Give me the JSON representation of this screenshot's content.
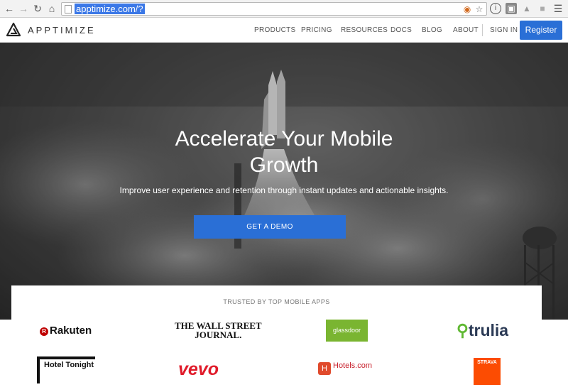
{
  "browser": {
    "url": "apptimize.com/?",
    "icons": [
      "back-icon",
      "forward-icon",
      "reload-icon",
      "home-icon",
      "page-icon",
      "extension-icon",
      "star-icon",
      "info-icon",
      "extension-2-icon",
      "drive-icon",
      "menu-icon"
    ]
  },
  "header": {
    "logo_text": "APPTIMIZE",
    "nav": [
      "PRODUCTS",
      "PRICING",
      "RESOURCES",
      "DOCS",
      "BLOG",
      "ABOUT",
      "SIGN IN"
    ],
    "register_label": "Register"
  },
  "hero": {
    "title_line1": "Accelerate Your Mobile",
    "title_line2": "Growth",
    "subtitle": "Improve user experience and retention through instant updates and actionable insights.",
    "cta_label": "GET A DEMO"
  },
  "trusted": {
    "label": "TRUSTED BY TOP MOBILE APPS",
    "logos": {
      "rakuten": "Rakuten",
      "wsj_line1": "THE WALL STREET",
      "wsj_line2": "JOURNAL.",
      "glassdoor": "glassdoor",
      "trulia": "trulia",
      "hoteltonight": "Hotel Tonight",
      "vevo": "vevo",
      "hotels": "Hotels.com",
      "strava": "STRAVA"
    }
  },
  "colors": {
    "accent": "#2a6fd6",
    "url_highlight": "#3b78e7"
  }
}
